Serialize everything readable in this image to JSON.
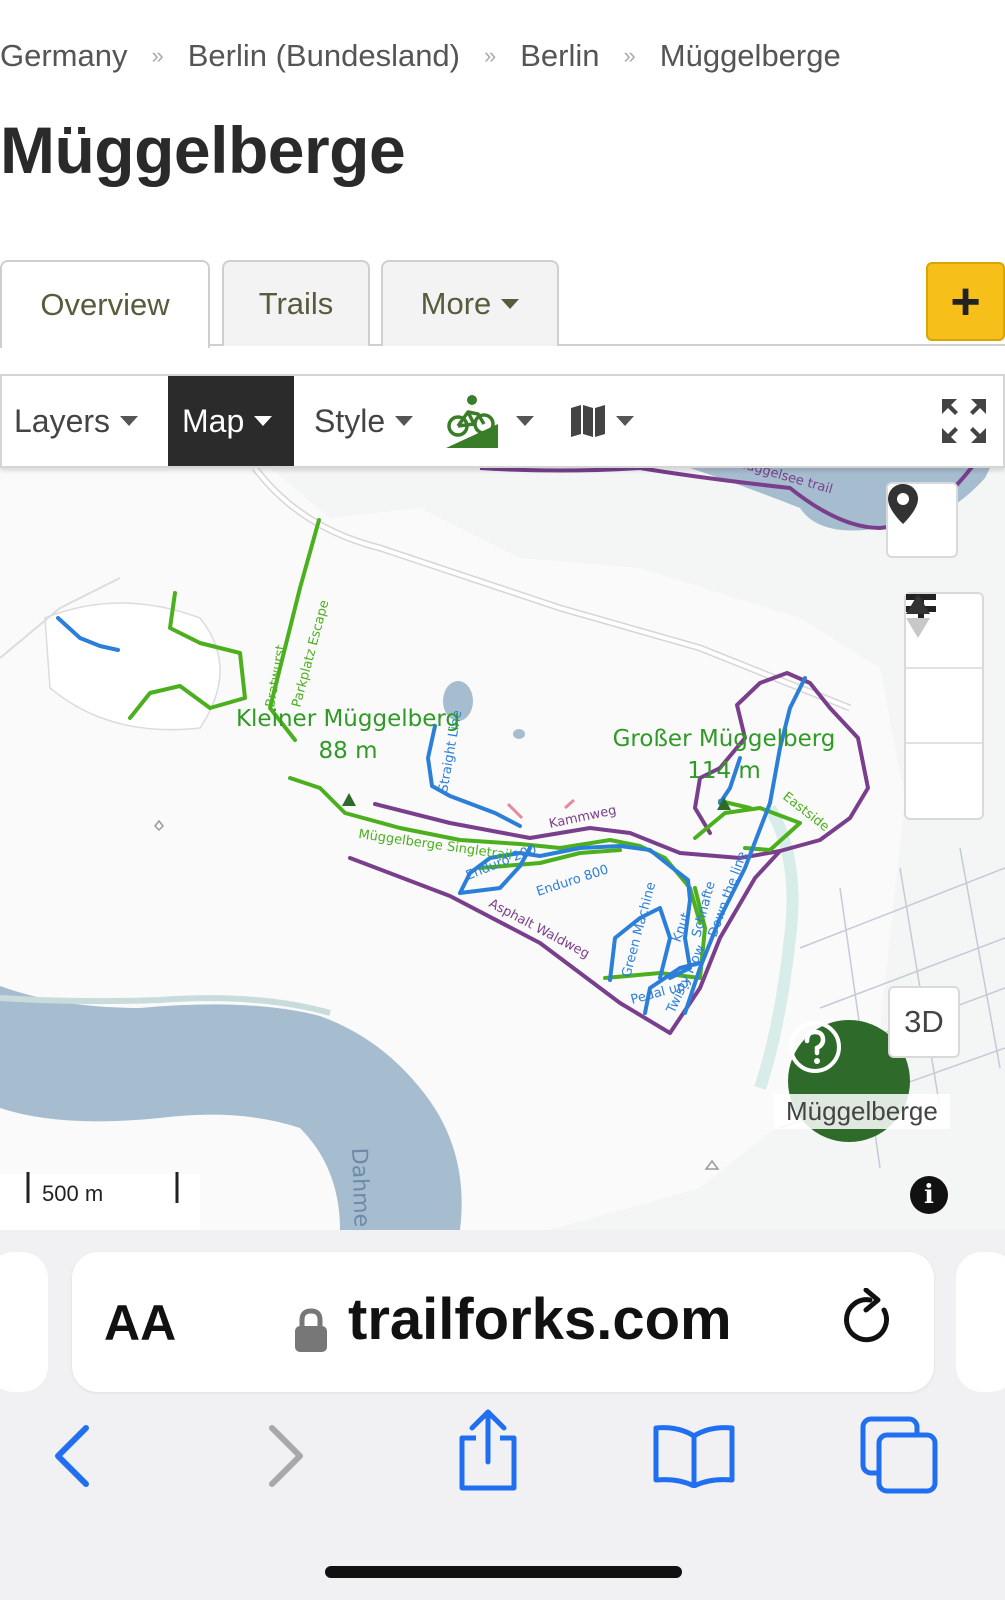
{
  "breadcrumb": [
    "Germany",
    "Berlin (Bundesland)",
    "Berlin",
    "Müggelberge"
  ],
  "breadcrumb_separator": "»",
  "page_title": "Müggelberge",
  "tabs": [
    {
      "label": "Overview",
      "active": true
    },
    {
      "label": "Trails",
      "active": false
    },
    {
      "label": "More",
      "active": false
    }
  ],
  "add_button_label": "+",
  "map_toolbar": {
    "layers": "Layers",
    "map": "Map",
    "style": "Style",
    "bike_icon": "mountain-bike-icon",
    "map_icon": "folded-map-icon",
    "fullscreen_icon": "fullscreen-icon"
  },
  "map": {
    "peaks": [
      {
        "name": "Kleiner Müggelberg",
        "elevation": "88 m"
      },
      {
        "name": "Großer Müggelberg",
        "elevation": "114 m"
      }
    ],
    "trail_labels": [
      "Müggelberge Singletrail",
      "Enduro 200",
      "Enduro 800",
      "Asphalt Waldweg",
      "Kammweg",
      "Straight Line",
      "Parkplatz Escape",
      "Bratwurst",
      "Eastside",
      "Green Machine",
      "Knut",
      "Schnafte",
      "Down the line",
      "Twisty Flow",
      "Pedal up!",
      "Müggelsee trail"
    ],
    "water_label": "Dahme",
    "scale_label": "500 m",
    "view_3d_label": "3D",
    "region_marker_label": "Müggelberge",
    "colors": {
      "green": "#4caf1e",
      "blue": "#2b7fd9",
      "purple": "#7a3f8c",
      "water": "#a6bccf",
      "marker": "#2e6b2a"
    }
  },
  "safari": {
    "aa_label": "AA",
    "url": "trailforks.com"
  }
}
